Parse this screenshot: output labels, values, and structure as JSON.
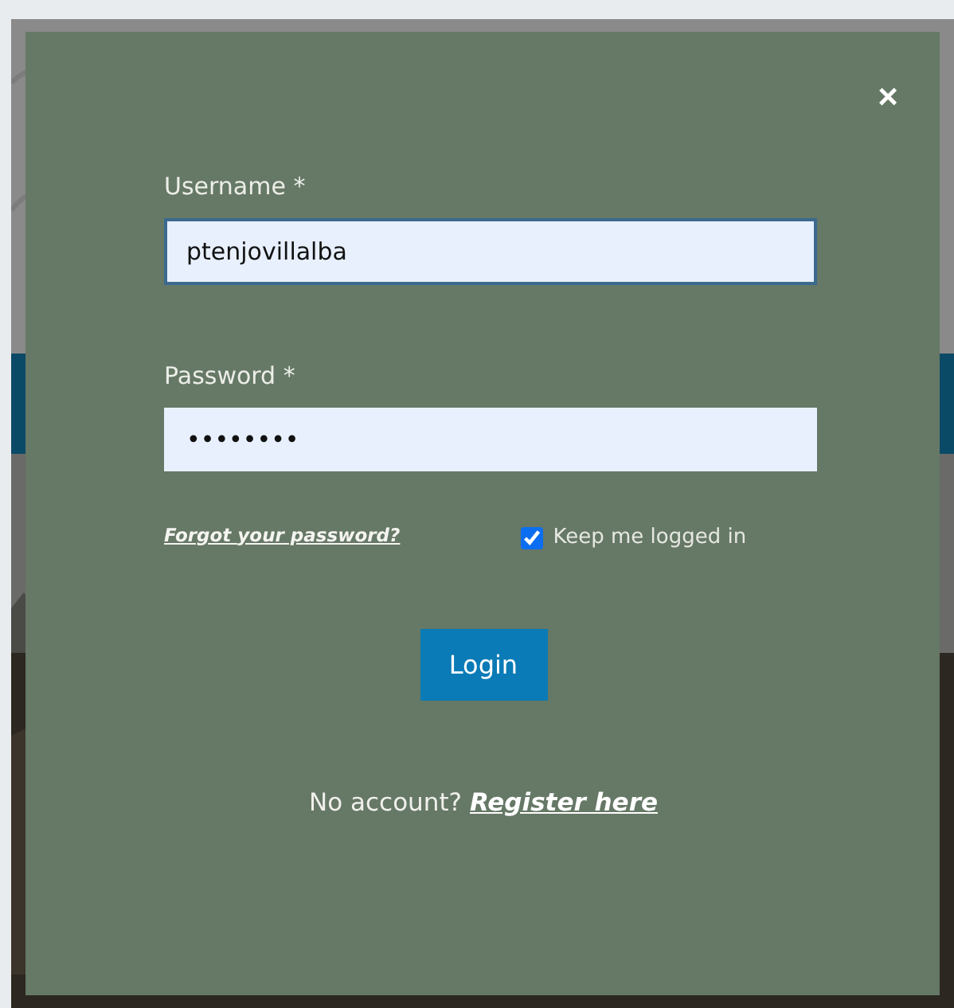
{
  "dialog": {
    "close": "×",
    "username": {
      "label": "Username *",
      "value": "ptenjovillalba"
    },
    "password": {
      "label": "Password *",
      "value": "••••••••"
    },
    "forgot_link": "Forgot your password?",
    "keep_logged_in": {
      "label": "Keep me logged in",
      "checked": true
    },
    "login_button": "Login",
    "register": {
      "text": "No account?",
      "link": "Register here"
    }
  }
}
